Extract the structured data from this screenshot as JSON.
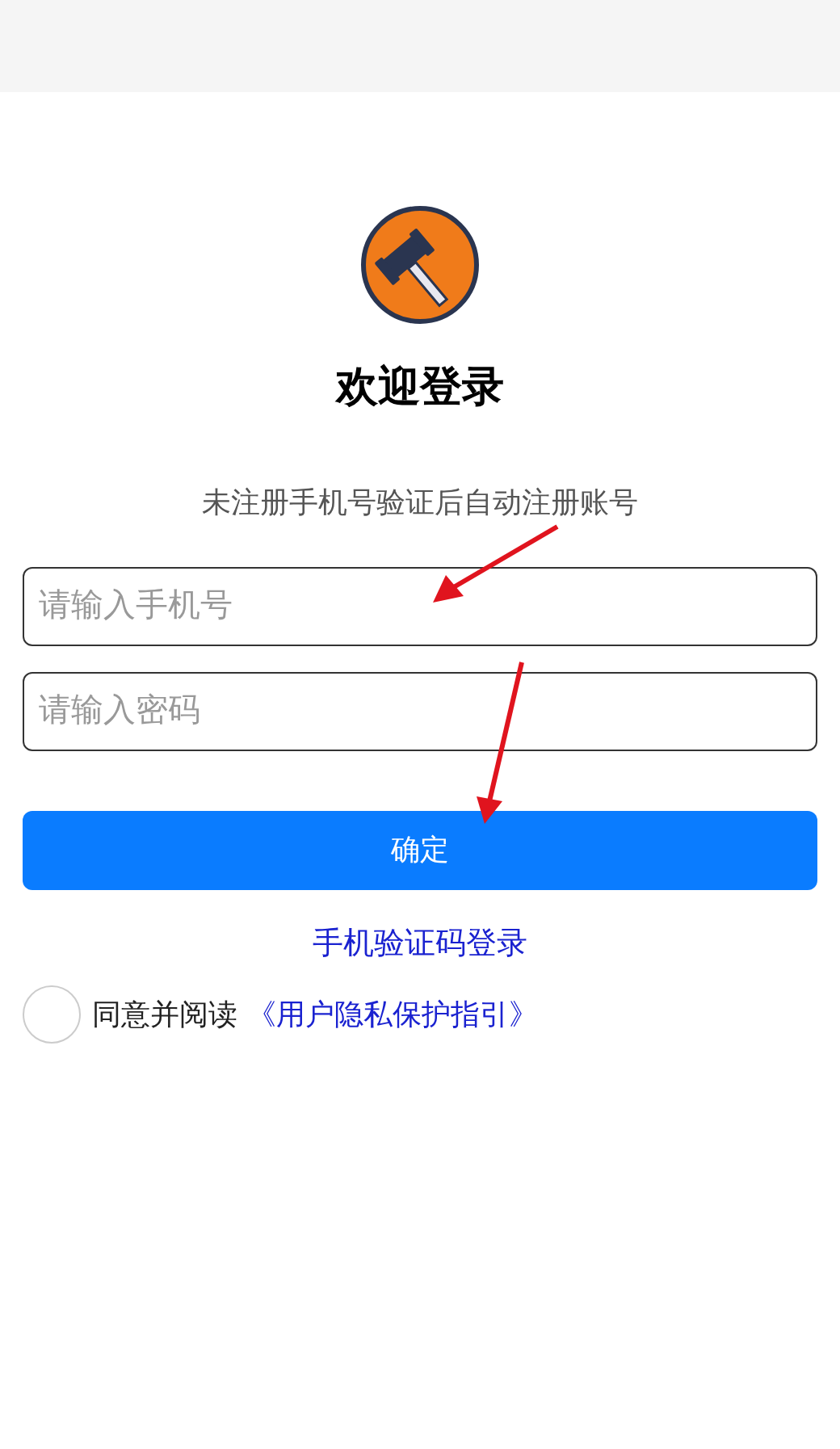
{
  "title": "欢迎登录",
  "subtitle": "未注册手机号验证后自动注册账号",
  "phone_field": {
    "placeholder": "请输入手机号"
  },
  "password_field": {
    "placeholder": "请输入密码"
  },
  "submit_button": "确定",
  "sms_login_link": "手机验证码登录",
  "agreement": {
    "checked": false,
    "text": "同意并阅读",
    "link": "《用户隐私保护指引》"
  }
}
